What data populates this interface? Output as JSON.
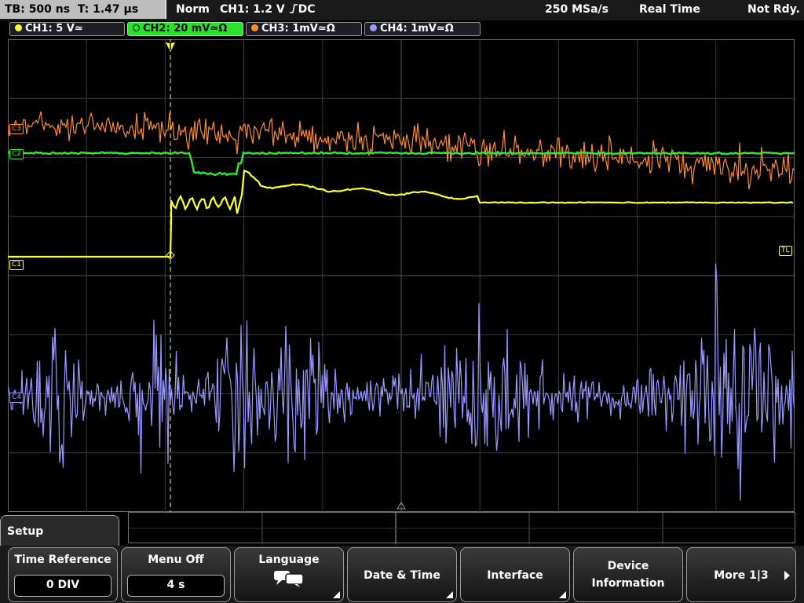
{
  "status": {
    "timebase": "TB: 500 ns",
    "trigger_time": "T: 1.47 µs",
    "mode": "Norm",
    "trigger_info": "CH1: 1.2 V ",
    "trigger_coupling": "DC",
    "sample_rate": "250 MSa/s",
    "acq_mode": "Real Time",
    "state": "Not Rdy."
  },
  "channels": [
    {
      "label": "CH1: 5 V≃",
      "color": "#ffff33"
    },
    {
      "label": "CH2: 20 mV≃Ω",
      "color": "#33e633"
    },
    {
      "label": "CH3: 1mV≃Ω",
      "color": "#ff8c33"
    },
    {
      "label": "CH4: 1mV≃Ω",
      "color": "#9999ff"
    }
  ],
  "markers": {
    "ch3": "C3",
    "ch2": "C2",
    "ch1": "C1",
    "ch4": "C4",
    "trigger_level": "TL"
  },
  "menu": {
    "title": "Setup",
    "time_reference": {
      "label": "Time Reference",
      "value": "0 DIV"
    },
    "menu_off": {
      "label": "Menu Off",
      "value": "4 s"
    },
    "language": {
      "label": "Language"
    },
    "date_time": {
      "label": "Date & Time"
    },
    "interface": {
      "label": "Interface"
    },
    "device_info": {
      "line1": "Device",
      "line2": "Information"
    },
    "more": {
      "label": "More 1|3"
    }
  }
}
